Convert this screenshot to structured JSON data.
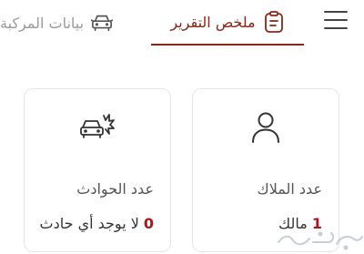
{
  "header": {
    "menu_icon": "hamburger-menu-icon",
    "tabs": [
      {
        "label": "ملخص التقرير",
        "icon": "report-clipboard-icon",
        "active": true
      },
      {
        "label": "بيانات المركبة",
        "icon": "car-front-icon",
        "active": false
      }
    ]
  },
  "cards": {
    "owners": {
      "icon": "person-icon",
      "title": "عدد الملاك",
      "count": "1",
      "value_text": "مالك"
    },
    "accidents": {
      "icon": "car-crash-icon",
      "title": "عدد الحوادث",
      "count": "0",
      "value_text": "لا يوجد أي حادث"
    }
  },
  "watermark": {
    "icon": "logo-watermark",
    "text": "حراج"
  },
  "colors": {
    "accent": "#8a2617",
    "count_red": "#b0141b",
    "inactive_tab": "#9a9a9a",
    "card_border": "#e6e6e6"
  }
}
